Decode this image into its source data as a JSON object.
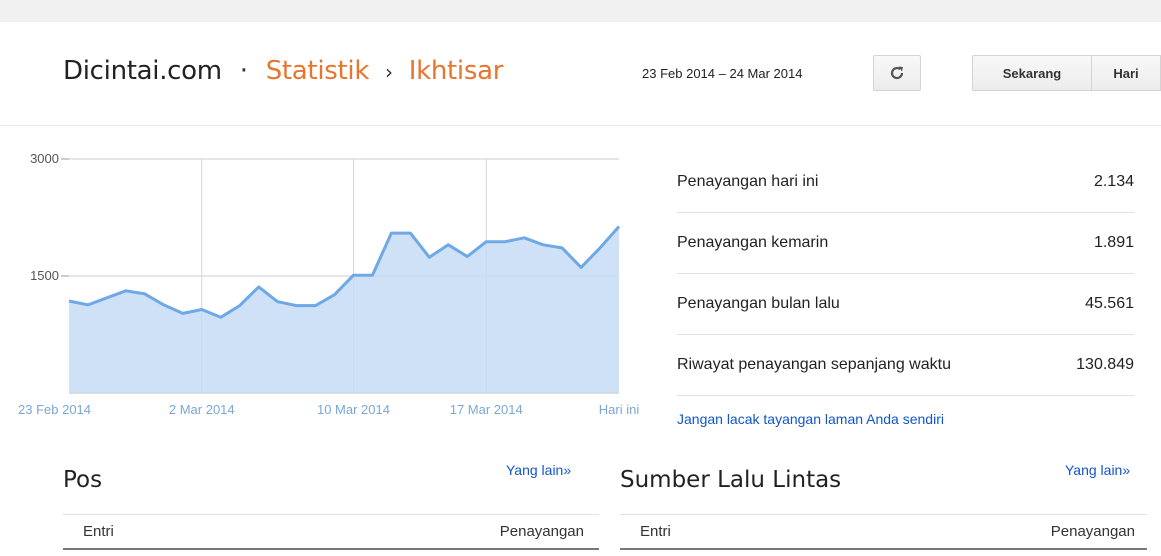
{
  "header": {
    "site": "Dicintai.com",
    "separator": "·",
    "crumb1": "Statistik",
    "crumb_arrow": "›",
    "crumb2": "Ikhtisar",
    "date_range": "23 Feb 2014 – 24 Mar 2014",
    "refresh_icon": "refresh-icon",
    "btn_now": "Sekarang",
    "btn_day": "Hari"
  },
  "colors": {
    "accent": "#e8752e",
    "line": "#6fa8e6",
    "fill": "#c6dcf5",
    "link": "#1155cc"
  },
  "chart_data": {
    "type": "area",
    "y_ticks": [
      "3000",
      "1500"
    ],
    "ylim": [
      0,
      3000
    ],
    "x_labels": [
      "23 Feb 2014",
      "2 Mar 2014",
      "10 Mar 2014",
      "17 Mar 2014",
      "Hari ini"
    ],
    "x_label_index": [
      0,
      7,
      15,
      22,
      29
    ],
    "grid": true,
    "x": [
      "23 Feb",
      "24 Feb",
      "25 Feb",
      "26 Feb",
      "27 Feb",
      "28 Feb",
      "1 Mar",
      "2 Mar",
      "3 Mar",
      "4 Mar",
      "5 Mar",
      "6 Mar",
      "7 Mar",
      "8 Mar",
      "9 Mar",
      "10 Mar",
      "11 Mar",
      "12 Mar",
      "13 Mar",
      "14 Mar",
      "15 Mar",
      "16 Mar",
      "17 Mar",
      "18 Mar",
      "19 Mar",
      "20 Mar",
      "21 Mar",
      "22 Mar",
      "23 Mar",
      "24 Mar"
    ],
    "values": [
      1180,
      1130,
      1220,
      1310,
      1270,
      1130,
      1020,
      1070,
      970,
      1120,
      1360,
      1170,
      1120,
      1120,
      1260,
      1510,
      1510,
      2050,
      2050,
      1740,
      1900,
      1750,
      1940,
      1940,
      1990,
      1900,
      1860,
      1610,
      1860,
      2134
    ]
  },
  "stats": [
    {
      "label": "Penayangan hari ini",
      "value": "2.134"
    },
    {
      "label": "Penayangan kemarin",
      "value": "1.891"
    },
    {
      "label": "Penayangan bulan lalu",
      "value": "45.561"
    },
    {
      "label": "Riwayat penayangan sepanjang waktu",
      "value": "130.849"
    }
  ],
  "track_link": "Jangan lacak tayangan laman Anda sendiri",
  "posts": {
    "title": "Pos",
    "more": "Yang lain»",
    "col1": "Entri",
    "col2": "Penayangan"
  },
  "traffic": {
    "title": "Sumber Lalu Lintas",
    "more": "Yang lain»",
    "col1": "Entri",
    "col2": "Penayangan"
  }
}
